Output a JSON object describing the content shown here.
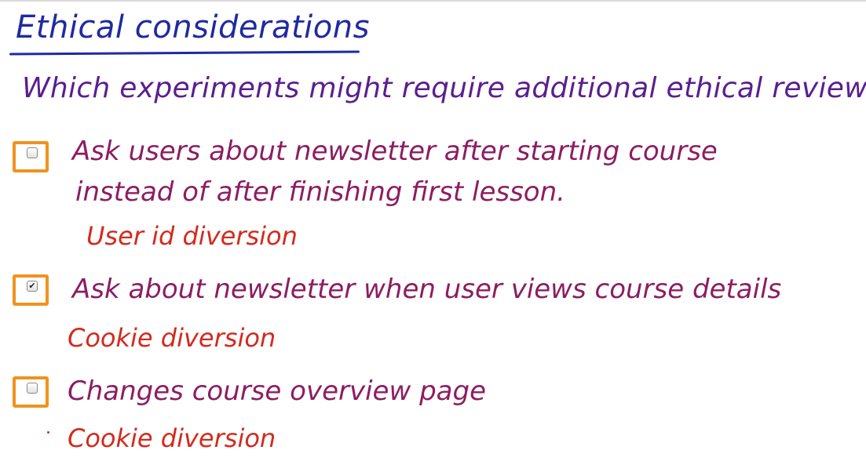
{
  "title": "Ethical considerations",
  "question": "Which experiments might require additional ethical review?",
  "options": [
    {
      "line1": "Ask users about newsletter after starting course",
      "line2": "instead of after finishing first lesson.",
      "checked": false,
      "answer": "User id diversion"
    },
    {
      "line1": "Ask about newsletter when user views course details",
      "checked": true,
      "answer": "Cookie diversion"
    },
    {
      "line1": "Changes course overview page",
      "checked": false,
      "answer": "Cookie diversion"
    }
  ],
  "colors": {
    "title": "#1f2aa0",
    "question": "#5a1f8f",
    "option_text": "#8c1d62",
    "answer": "#d42a1e",
    "checkbox_frame": "#f0931e"
  },
  "icons": {
    "checkmark": "checkmark-icon"
  }
}
